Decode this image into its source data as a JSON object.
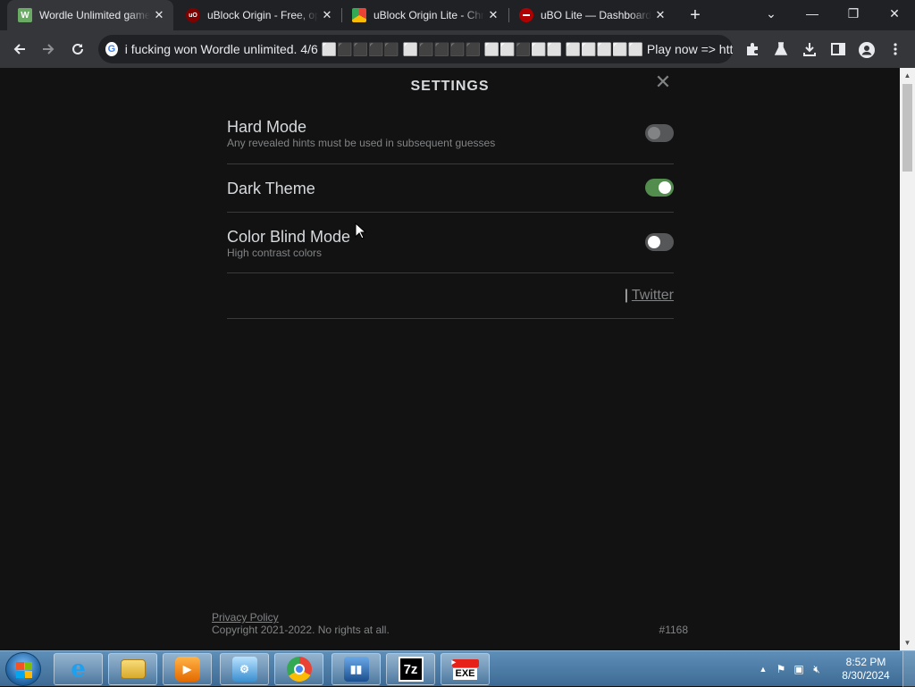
{
  "browser": {
    "tabs": [
      {
        "title": "Wordle Unlimited game",
        "favicon_text": "W",
        "favicon_color": "#6aaa64",
        "active": true
      },
      {
        "title": "uBlock Origin - Free, open-source ad content blocker",
        "favicon_text": "uO",
        "favicon_color": "#800000",
        "active": false
      },
      {
        "title": "uBlock Origin Lite - Chrome Web Store",
        "favicon_text": "",
        "favicon_color": "#ea4335",
        "active": false
      },
      {
        "title": "uBO Lite — Dashboard",
        "favicon_text": "",
        "favicon_color": "#b00000",
        "active": false
      }
    ],
    "new_tab_label": "+",
    "close_tab_label": "✕",
    "window_controls": {
      "tabsearch": "⌄",
      "minimize": "—",
      "restore": "❐",
      "close": "✕"
    },
    "address_bar": {
      "text": "i fucking won Wordle unlimited. 4/6 ⬜⬛⬛⬛⬛ ⬜⬛⬛⬛⬛ ⬜⬜⬛⬜⬜ ⬜⬜⬜⬜⬜ Play now => https://wordleunlim..."
    },
    "toolbar_icons": [
      "back-icon",
      "forward-icon",
      "reload-icon",
      "extensions-icon",
      "labs-icon",
      "download-icon",
      "sidepanel-icon",
      "profile-icon",
      "menu-icon"
    ]
  },
  "settings": {
    "title": "SETTINGS",
    "close_label": "✕",
    "items": [
      {
        "label": "Hard Mode",
        "description": "Any revealed hints must be used in subsequent guesses",
        "enabled": false
      },
      {
        "label": "Dark Theme",
        "description": "",
        "enabled": true
      },
      {
        "label": "Color Blind Mode",
        "description": "High contrast colors",
        "enabled": false
      }
    ],
    "links": {
      "separator": "|",
      "twitter": "Twitter"
    }
  },
  "footer": {
    "privacy": "Privacy Policy",
    "copyright": "Copyright 2021-2022. No rights at all.",
    "build": "#1168"
  },
  "taskbar": {
    "apps": [
      "internet-explorer",
      "file-explorer",
      "media-player",
      "control-panel",
      "chrome",
      "app-tower",
      "7zip",
      "youtube-exe"
    ],
    "app_7zip_label": "7z",
    "app_exe_label": "EXE",
    "clock_time": "8:52 PM",
    "clock_date": "8/30/2024"
  },
  "colors": {
    "page_bg": "#121213",
    "toggle_on": "#538d4e",
    "toggle_off": "#565758",
    "text": "#d7dadc",
    "muted": "#818384"
  }
}
